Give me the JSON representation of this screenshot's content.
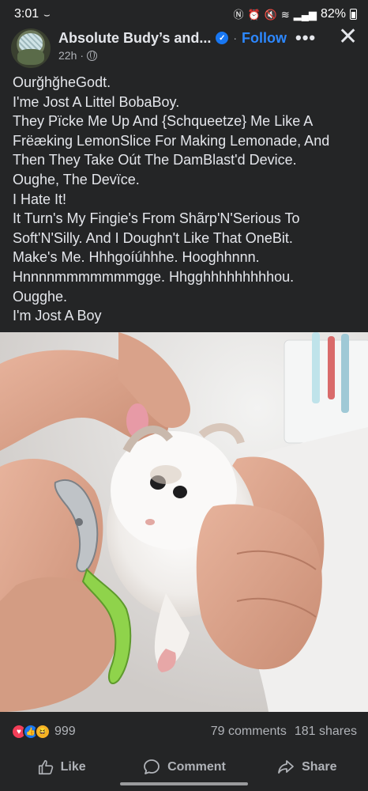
{
  "status_bar": {
    "time": "3:01",
    "battery": "82%"
  },
  "post": {
    "page_name": "Absolute Budy’s and...",
    "separator": "·",
    "follow_label": "Follow",
    "time_ago": "22h",
    "meta_separator": "·",
    "more_label": "•••",
    "close_label": "✕",
    "text_lines": [
      "OurğhğheGodt.",
      "I'me Jost A Littel BobaBoy.",
      "They Pïcke Me Up And {Schqueetze} Me Like A",
      "Frëæking LemonSlice For Making Lemonade, And",
      "Then They Take Oút The DamBlast'd Device.",
      "Oughe, The Devïce.",
      "I Hate It!",
      "It Turn's My Fingie's From Shãrp'N'Serious To",
      "Soft'N'Silly. And I Doughn't Like That OneBit.",
      "Make's Me. Hhhgoíúhhhe. Hooghhnnn.",
      "Hnnnnmmmmmmmgge. Hhgghhhhhhhhhou.",
      "Ougghe.",
      "I'm Jost A Boy"
    ]
  },
  "engagement": {
    "reaction_count": "999",
    "comments": "79 comments",
    "shares": "181 shares"
  },
  "actions": {
    "like_label": "Like",
    "comment_label": "Comment",
    "share_label": "Share"
  },
  "colors": {
    "background": "#242526",
    "accent": "#2d88ff",
    "text": "#e4e6eb",
    "muted": "#b0b3b8"
  }
}
